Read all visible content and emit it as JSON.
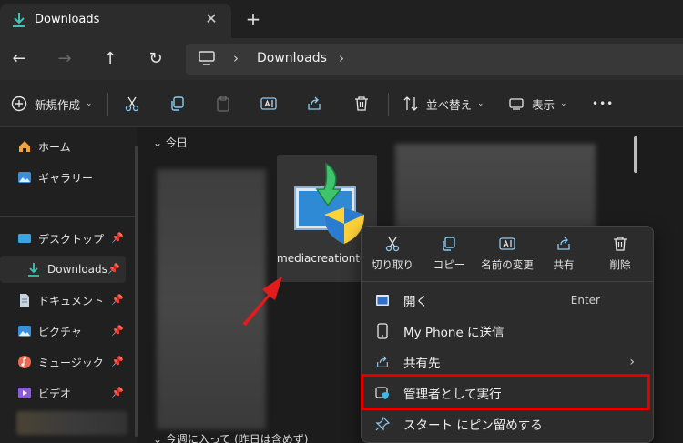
{
  "tab": {
    "title": "Downloads",
    "close": "✕",
    "new_tab": "+"
  },
  "nav": {
    "back": "←",
    "forward": "→",
    "up": "↑",
    "refresh": "↻"
  },
  "address": {
    "sep1": "›",
    "crumb": "Downloads",
    "sep2": "›"
  },
  "toolbar": {
    "new_label": "新規作成",
    "sort_label": "並べ替え",
    "view_label": "表示",
    "more": "•••"
  },
  "sidebar": {
    "items": [
      {
        "label": "ホーム"
      },
      {
        "label": "ギャラリー"
      },
      {
        "label": "デスクトップ"
      },
      {
        "label": "Downloads"
      },
      {
        "label": "ドキュメント"
      },
      {
        "label": "ピクチャ"
      },
      {
        "label": "ミュージック"
      },
      {
        "label": "ビデオ"
      }
    ]
  },
  "content": {
    "group_today": "今日",
    "group_week": "今週に入って (昨日は含めず)",
    "file_name": "mediacreationtool.exe"
  },
  "context_menu": {
    "quick_actions": [
      {
        "label": "切り取り"
      },
      {
        "label": "コピー"
      },
      {
        "label": "名前の変更"
      },
      {
        "label": "共有"
      },
      {
        "label": "削除"
      }
    ],
    "items": [
      {
        "label": "開く",
        "accel": "Enter"
      },
      {
        "label": "My Phone に送信"
      },
      {
        "label": "共有先",
        "submenu": "›"
      },
      {
        "label": "管理者として実行"
      },
      {
        "label": "スタート にピン留めする"
      }
    ]
  },
  "colors": {
    "accent": "#3fb7e6",
    "highlight": "#e00000",
    "download_green": "#3ec46d"
  }
}
